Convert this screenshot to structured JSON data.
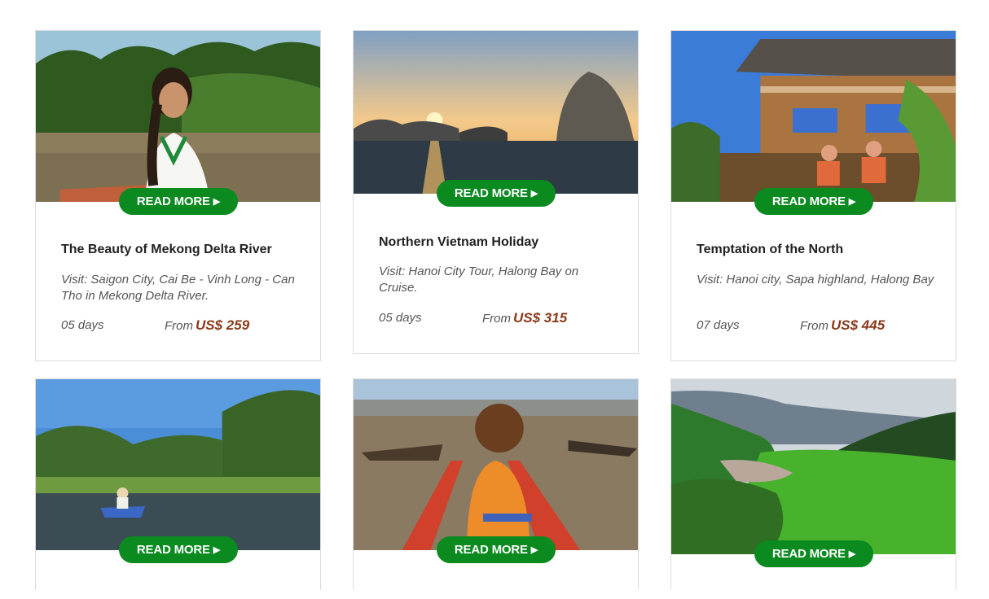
{
  "read_more_label": "READ MORE",
  "tours": [
    {
      "title": "The Beauty of Mekong Delta River",
      "visit": "Visit: Saigon City, Cai Be - Vinh Long - Can Tho in Mekong Delta River.",
      "days": "05 days",
      "from_label": "From",
      "price": "US$ 259",
      "image": "mekong-woman-boat"
    },
    {
      "title": "Northern Vietnam Holiday",
      "visit": "Visit: Hanoi City Tour, Halong Bay on Cruise.",
      "days": "05 days",
      "from_label": "From",
      "price": "US$ 315",
      "image": "halong-bay-sunset"
    },
    {
      "title": "Temptation of the North",
      "visit": "Visit: Hanoi city, Sapa highland, Halong Bay",
      "days": "07 days",
      "from_label": "From",
      "price": "US$ 445",
      "image": "sapa-wooden-house"
    },
    {
      "image": "river-canoe"
    },
    {
      "image": "floating-market"
    },
    {
      "image": "green-valley"
    }
  ],
  "colors": {
    "button": "#0a8a1f",
    "price": "#8a3a1a"
  }
}
